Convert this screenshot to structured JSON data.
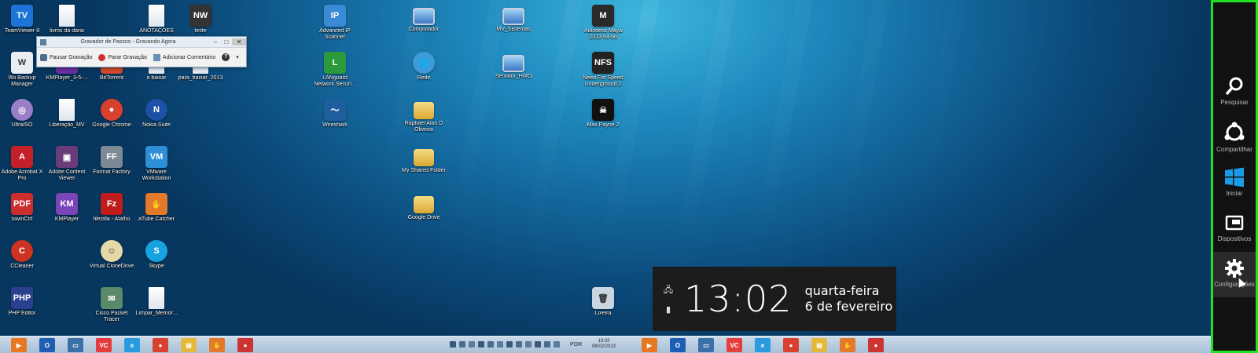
{
  "desktop_icons": [
    {
      "label": "TeamViewer 8",
      "icon": "teamviewer-icon",
      "color": "#1e73d8",
      "glyph": "TV"
    },
    {
      "label": "livros da daria",
      "icon": "document-icon",
      "kind": "doc"
    },
    {
      "label": "ANOTAÇÕES",
      "icon": "document-icon",
      "kind": "doc"
    },
    {
      "label": "teste",
      "icon": "app-icon",
      "color": "#333333",
      "glyph": "NW"
    },
    {
      "label": "Wii Backup Manager",
      "icon": "wii-icon",
      "color": "#e9eef3",
      "glyph": "W"
    },
    {
      "label": "KMPlayer_3-5-...",
      "icon": "kmplayer-icon",
      "color": "#6b2fa3",
      "glyph": "KM"
    },
    {
      "label": "BitTorrent",
      "icon": "bittorrent-icon",
      "color": "#d24a2a",
      "glyph": "B"
    },
    {
      "label": "a baixar",
      "icon": "document-icon",
      "kind": "doc"
    },
    {
      "label": "para_baixar_2013",
      "icon": "document-icon",
      "kind": "doc"
    },
    {
      "label": "UltraISO",
      "icon": "disc-icon",
      "color": "#9a7fc8",
      "glyph": "◎",
      "round": true
    },
    {
      "label": "Liberação_MV",
      "icon": "document-icon",
      "kind": "doc"
    },
    {
      "label": "Google Chrome",
      "icon": "chrome-icon",
      "color": "#d8402f",
      "glyph": "●",
      "round": true
    },
    {
      "label": "Nokia Suite",
      "icon": "nokia-icon",
      "color": "#1c52a6",
      "glyph": "N",
      "round": true
    },
    {
      "label": "Adobe Acrobat X Pro",
      "icon": "acrobat-icon",
      "color": "#c4202a",
      "glyph": "A"
    },
    {
      "label": "Adobe Content Viewer",
      "icon": "adobe-viewer-icon",
      "color": "#6a3d7a",
      "glyph": "▣"
    },
    {
      "label": "Format Factory",
      "icon": "format-factory-icon",
      "color": "#7d8a96",
      "glyph": "FF"
    },
    {
      "label": "VMware Workstation",
      "icon": "vmware-icon",
      "color": "#2d8fd6",
      "glyph": "VM"
    },
    {
      "label": "siwinCtrl",
      "icon": "pdf-icon",
      "color": "#cc2d2d",
      "glyph": "PDF"
    },
    {
      "label": "KMPlayer",
      "icon": "kmplayer-icon",
      "color": "#7a45b8",
      "glyph": "KM"
    },
    {
      "label": "filezilla - Atalho",
      "icon": "filezilla-icon",
      "color": "#bf1d1d",
      "glyph": "Fz"
    },
    {
      "label": "aTube Catcher",
      "icon": "atube-icon",
      "color": "#e3792a",
      "glyph": "✋"
    },
    {
      "label": "CCleaner",
      "icon": "ccleaner-icon",
      "color": "#cc3322",
      "glyph": "C",
      "round": true
    },
    {
      "label": "Virtual CloneDrive",
      "icon": "clonedrive-icon",
      "color": "#e6d9a8",
      "glyph": "☺",
      "round": true
    },
    {
      "label": "Skype",
      "icon": "skype-icon",
      "color": "#17a3e0",
      "glyph": "S",
      "round": true
    },
    {
      "label": "PHP Editor",
      "icon": "php-icon",
      "color": "#2b3f8f",
      "glyph": "PHP"
    },
    {
      "label": "Cisco Packet Tracer",
      "icon": "packet-tracer-icon",
      "color": "#5a8a6a",
      "glyph": "✉"
    },
    {
      "label": "Limpar_Memor...",
      "icon": "document-icon",
      "kind": "doc"
    },
    {
      "label": "Advanced IP Scanner",
      "icon": "ip-scanner-icon",
      "color": "#3a8ad6",
      "glyph": "IP"
    },
    {
      "label": "LANguard Network Securi...",
      "icon": "languard-icon",
      "color": "#2a9a3a",
      "glyph": "L"
    },
    {
      "label": "Wireshark",
      "icon": "wireshark-icon",
      "color": "#1f5f9e",
      "glyph": "〜"
    },
    {
      "label": "Computador",
      "icon": "computer-icon",
      "kind": "mon"
    },
    {
      "label": "Rede",
      "icon": "network-icon",
      "color": "#3f9bd8",
      "glyph": "🌐",
      "round": true
    },
    {
      "label": "Raphael Alan D Oliveira",
      "icon": "folder-icon",
      "kind": "fold"
    },
    {
      "label": "My Shared Folder",
      "icon": "folder-icon",
      "kind": "fold"
    },
    {
      "label": "Google Drive",
      "icon": "google-drive-icon",
      "kind": "fold"
    },
    {
      "label": "MV_Sistemas",
      "icon": "computer-icon",
      "kind": "mon"
    },
    {
      "label": "Servidor_HMO",
      "icon": "computer-icon",
      "kind": "mon"
    },
    {
      "label": "Autodesk Maya 2013 64-bit",
      "icon": "maya-icon",
      "color": "#2a2a2a",
      "glyph": "M"
    },
    {
      "label": "Need For Speed Underground 2",
      "icon": "nfs-icon",
      "color": "#222222",
      "glyph": "NFS"
    },
    {
      "label": "Max Payne 2",
      "icon": "max-payne-icon",
      "color": "#111111",
      "glyph": "☠"
    },
    {
      "label": "Lixeira",
      "icon": "recycle-bin-icon",
      "color": "#c9d6e2",
      "glyph": "🗑"
    }
  ],
  "steps_recorder": {
    "title": "Gravador de Passos - Gravando Agora",
    "pause": "Pausar Gravação",
    "stop": "Parar Gravação",
    "comment": "Adicionar Comentário",
    "help": "?",
    "minimize": "–",
    "maximize": "□",
    "close": "✕"
  },
  "charms": [
    {
      "label": "Pesquisar",
      "icon": "search-icon"
    },
    {
      "label": "Compartilhar",
      "icon": "share-icon"
    },
    {
      "label": "Iniciar",
      "icon": "windows-logo-icon"
    },
    {
      "label": "Dispositivos",
      "icon": "devices-icon"
    },
    {
      "label": "Configurações",
      "icon": "gear-icon",
      "active": true
    }
  ],
  "clock": {
    "time": "13:02",
    "weekday": "quarta-feira",
    "date": "6 de fevereiro"
  },
  "taskbar": {
    "left_apps": [
      {
        "icon": "media-player-icon",
        "color": "#e87722",
        "glyph": "▶"
      },
      {
        "icon": "outlook-icon",
        "color": "#1e5fb3",
        "glyph": "O"
      },
      {
        "icon": "remote-desktop-icon",
        "color": "#3b6fa8",
        "glyph": "▭"
      },
      {
        "icon": "vc-icon",
        "color": "#e33d3d",
        "glyph": "VC"
      },
      {
        "icon": "internet-explorer-icon",
        "color": "#2b9be0",
        "glyph": "e"
      },
      {
        "icon": "chrome-icon",
        "color": "#d8402f",
        "glyph": "●"
      },
      {
        "icon": "file-explorer-icon",
        "color": "#e4b83a",
        "glyph": "▤"
      },
      {
        "icon": "atube-icon",
        "color": "#e3792a",
        "glyph": "✋"
      },
      {
        "icon": "steps-recorder-icon",
        "color": "#cc3333",
        "glyph": "●"
      }
    ],
    "right_apps": [
      {
        "icon": "media-player-icon",
        "color": "#e87722",
        "glyph": "▶"
      },
      {
        "icon": "outlook-icon",
        "color": "#1e5fb3",
        "glyph": "O"
      },
      {
        "icon": "remote-desktop-icon",
        "color": "#3b6fa8",
        "glyph": "▭"
      },
      {
        "icon": "vc-icon",
        "color": "#e33d3d",
        "glyph": "VC"
      },
      {
        "icon": "internet-explorer-icon",
        "color": "#2b9be0",
        "glyph": "e"
      },
      {
        "icon": "chrome-icon",
        "color": "#d8402f",
        "glyph": "●"
      },
      {
        "icon": "file-explorer-icon",
        "color": "#e4b83a",
        "glyph": "▤"
      },
      {
        "icon": "atube-icon",
        "color": "#e3792a",
        "glyph": "✋"
      },
      {
        "icon": "steps-recorder-icon",
        "color": "#cc3333",
        "glyph": "●"
      }
    ],
    "language": "POR",
    "tray_time": "13:02",
    "tray_date": "06/02/2013"
  },
  "colors": {
    "charm_highlight": "#22e022",
    "charms_bg": "#111111",
    "clock_bg": "#1c1c1c"
  }
}
